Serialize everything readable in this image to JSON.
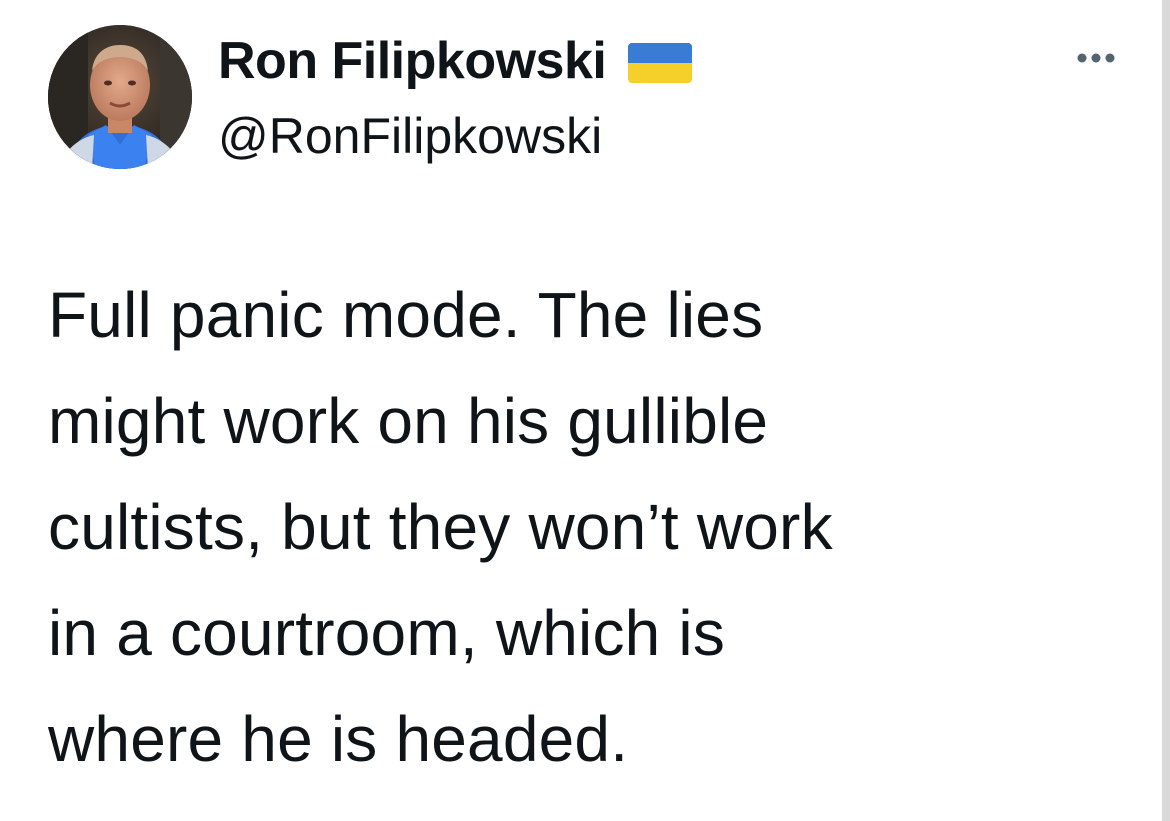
{
  "author": {
    "display_name": "Ron Filipkowski",
    "handle": "@RonFilipkowski",
    "avatar_icon": "profile-photo",
    "flag_icon": "ukraine-flag-icon",
    "flag_colors": {
      "top": "#3a7bd5",
      "bottom": "#f5d02b"
    }
  },
  "menu": {
    "more_icon": "more-horizontal-icon"
  },
  "tweet": {
    "text": "Full panic mode. The lies\nmight work on his gullible\ncultists, but they won’t work\nin a courtroom, which is\nwhere he is headed."
  }
}
